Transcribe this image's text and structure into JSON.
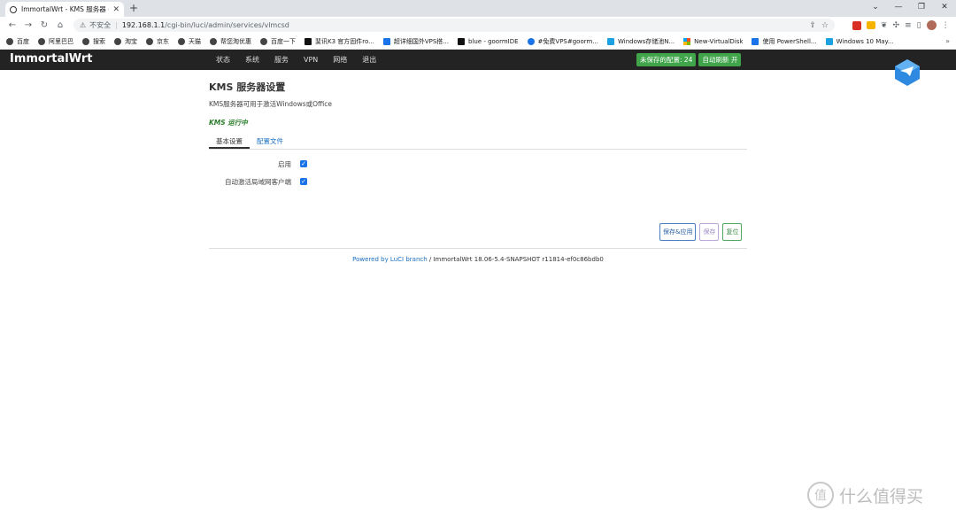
{
  "browser": {
    "tab_title": "ImmortalWrt - KMS 服务器 - L",
    "omnibox": {
      "security_label": "不安全",
      "url_host": "192.168.1.1",
      "url_path": "/cgi-bin/luci/admin/services/vlmcsd"
    },
    "bookmarks": [
      "百度",
      "阿里巴巴",
      "搜索",
      "淘宝",
      "京东",
      "天猫",
      "帮您淘优惠",
      "百度一下",
      "斐讯K3 官方固件ro...",
      "超详细国外VPS搭...",
      "blue - goormIDE",
      "#免费VPS#goorm...",
      "Windows存储池N...",
      "New-VirtualDisk",
      "使用 PowerShell...",
      "Windows 10 May..."
    ]
  },
  "luci": {
    "brand": "ImmortalWrt",
    "menu": [
      "状态",
      "系统",
      "服务",
      "VPN",
      "网络",
      "退出"
    ],
    "unsaved_badge": "未保存的配置: 24",
    "autorefresh_badge": "自动刷新 开"
  },
  "page": {
    "title": "KMS 服务器设置",
    "description": "KMS服务器可用于激活Windows或Office",
    "status": "KMS 运行中",
    "tabs": [
      "基本设置",
      "配置文件"
    ],
    "fields": [
      {
        "label": "启用",
        "checked": true
      },
      {
        "label": "自动激活局域网客户端",
        "checked": true
      }
    ],
    "buttons": {
      "save_apply": "保存&应用",
      "save": "保存",
      "reset": "复位"
    },
    "footer": {
      "link_text": "Powered by LuCI branch",
      "version_text": " / ImmortalWrt 18.06-5.4-SNAPSHOT r11814-ef0c86bdb0"
    }
  },
  "watermark": {
    "text": "什么值得买",
    "icon_glyph": "值"
  },
  "colors": {
    "header_bg": "#232323",
    "badge_green": "#3fa44a",
    "link_blue": "#1a6fc2",
    "status_green": "#2a7f2a"
  }
}
